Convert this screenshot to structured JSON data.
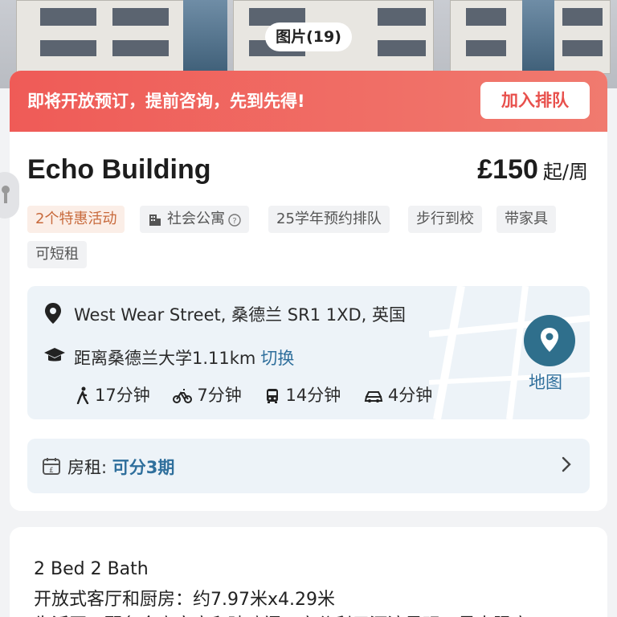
{
  "photos": {
    "count_label": "图片(19)"
  },
  "promo": {
    "text": "即将开放预订，提前咨询，先到先得!",
    "button_label": "加入排队"
  },
  "property": {
    "name": "Echo Building",
    "price": "£150",
    "price_unit": "起/周"
  },
  "tags": [
    {
      "label": "2个特惠活动"
    },
    {
      "label": "社会公寓"
    },
    {
      "label": "25学年预约排队"
    },
    {
      "label": "步行到校"
    },
    {
      "label": "带家具"
    },
    {
      "label": "可短租"
    }
  ],
  "location": {
    "address": "West Wear Street, 桑德兰 SR1 1XD, 英国",
    "distance": "距离桑德兰大学1.11km",
    "switch_label": "切换",
    "map_label": "地图",
    "commute": [
      {
        "icon": "walk-icon",
        "label": "17分钟"
      },
      {
        "icon": "bike-icon",
        "label": "7分钟"
      },
      {
        "icon": "bus-icon",
        "label": "14分钟"
      },
      {
        "icon": "car-icon",
        "label": "4分钟"
      }
    ]
  },
  "rent": {
    "label": "房租:",
    "value": "可分3期"
  },
  "description": {
    "lines": [
      "2 Bed 2 Bath",
      "开放式客厅和厨房：约7.97米x4.29米",
      "生活区，配备全高窗户和玻璃门，充分利用河滨景观，最大限度"
    ]
  },
  "colors": {
    "promo": "#ef5b57",
    "accent_blue": "#2f6f9c",
    "hot_tag_text": "#c86a3c"
  }
}
